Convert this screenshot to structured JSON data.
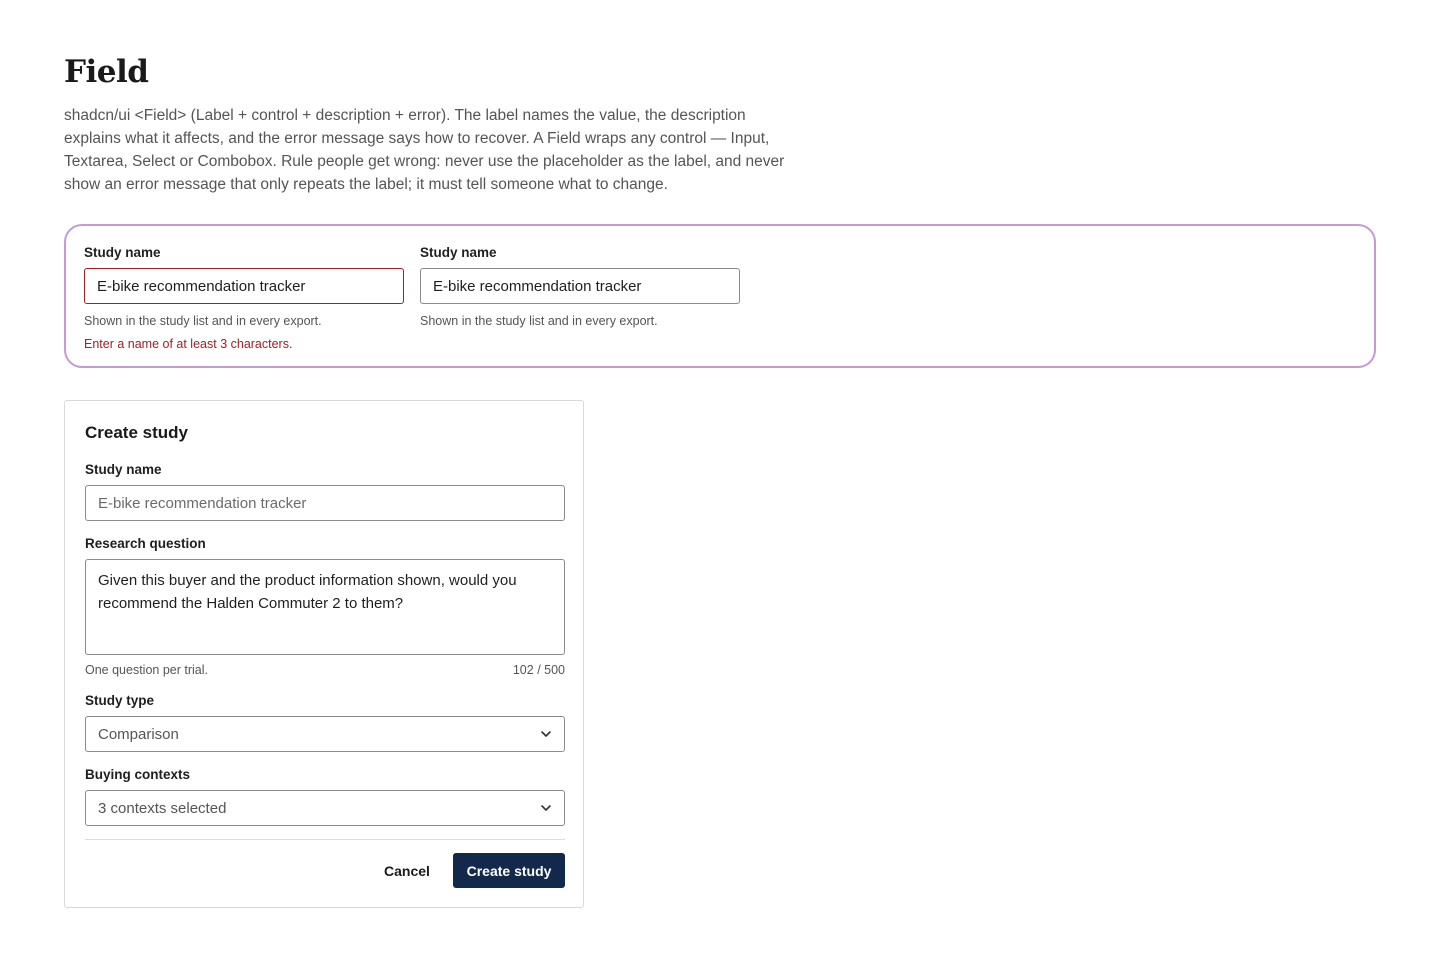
{
  "page": {
    "title": "Field",
    "description": "shadcn/ui <Field> (Label + control + description + error). The label names the value, the description explains what it affects, and the error message says how to recover. A Field wraps any control — Input, Textarea, Select or Combobox. Rule people get wrong: never use the placeholder as the label, and never show an error message that only repeats the label; it must tell someone what to change."
  },
  "demo": {
    "error_field": {
      "label": "Study name",
      "value": "E-bike recommendation tracker",
      "description": "Shown in the study list and in every export.",
      "error": "Enter a name of at least 3 characters."
    },
    "normal_field": {
      "label": "Study name",
      "value": "E-bike recommendation tracker",
      "description": "Shown in the study list and in every export."
    },
    "error_color": "#9b2226",
    "highlight_color": "#c39ad8"
  },
  "form": {
    "title": "Create study",
    "study_name": {
      "label": "Study name",
      "placeholder": "E-bike recommendation tracker"
    },
    "research_question": {
      "label": "Research question",
      "value": "Given this buyer and the product information shown, would you recommend the Halden Commuter 2 to them?",
      "description": "One question per trial.",
      "counter": "102 / 500"
    },
    "study_type": {
      "label": "Study type",
      "value": "Comparison",
      "icon": "chevron-down-icon"
    },
    "buying_contexts": {
      "label": "Buying contexts",
      "value": "3 contexts selected",
      "icon": "chevron-down-icon"
    },
    "cancel_label": "Cancel",
    "submit_label": "Create study",
    "primary_color": "#13294b"
  }
}
